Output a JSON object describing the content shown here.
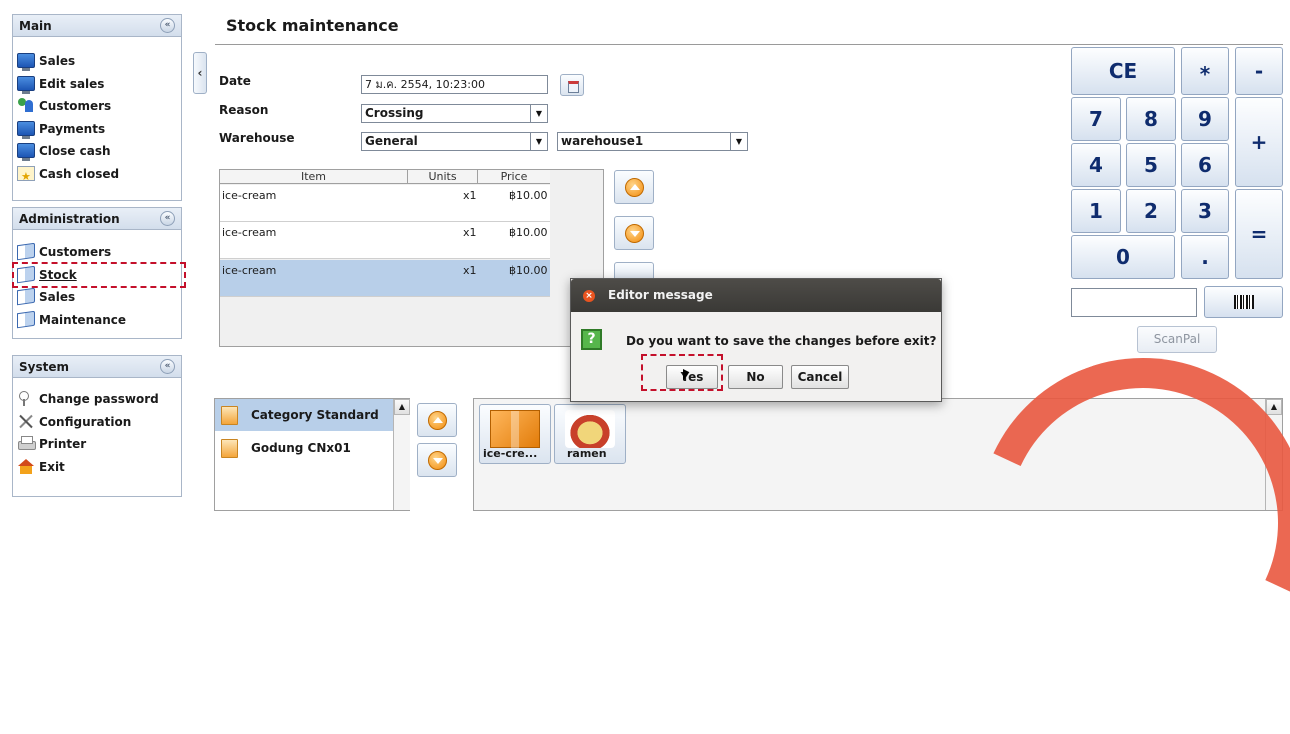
{
  "sidebar": {
    "main": {
      "title": "Main",
      "items": [
        {
          "label": "Sales",
          "icon": "monitor-icon"
        },
        {
          "label": "Edit sales",
          "icon": "monitor-icon"
        },
        {
          "label": "Customers",
          "icon": "people-icon"
        },
        {
          "label": "Payments",
          "icon": "monitor-icon"
        },
        {
          "label": "Close cash",
          "icon": "monitor-icon"
        },
        {
          "label": "Cash closed",
          "icon": "calendar-star-icon"
        }
      ]
    },
    "administration": {
      "title": "Administration",
      "items": [
        {
          "label": "Customers",
          "icon": "book-icon"
        },
        {
          "label": "Stock",
          "icon": "book-icon"
        },
        {
          "label": "Sales",
          "icon": "book-icon"
        },
        {
          "label": "Maintenance",
          "icon": "book-icon"
        }
      ]
    },
    "system": {
      "title": "System",
      "items": [
        {
          "label": "Change password",
          "icon": "key-icon"
        },
        {
          "label": "Configuration",
          "icon": "tools-icon"
        },
        {
          "label": "Printer",
          "icon": "printer-icon"
        },
        {
          "label": "Exit",
          "icon": "home-icon"
        }
      ]
    },
    "collapse_glyph": "«",
    "toggle_glyph": "‹"
  },
  "main": {
    "title": "Stock maintenance",
    "form": {
      "date_label": "Date",
      "date_value": "7 ม.ค. 2554, 10:23:00",
      "reason_label": "Reason",
      "reason_value": "Crossing",
      "warehouse_label": "Warehouse",
      "warehouse_value": "General",
      "warehouse2_value": "warehouse1"
    },
    "table": {
      "columns": [
        "Item",
        "Units",
        "Price"
      ],
      "rows": [
        {
          "item": "ice-cream",
          "units": "x1",
          "price": "฿10.00"
        },
        {
          "item": "ice-cream",
          "units": "x1",
          "price": "฿10.00"
        },
        {
          "item": "ice-cream",
          "units": "x1",
          "price": "฿10.00"
        }
      ],
      "selected_row": 2
    }
  },
  "numpad": {
    "keys": {
      "ce": "CE",
      "mul": "*",
      "minus": "-",
      "plus": "+",
      "eq": "=",
      "dot": ".",
      "k7": "7",
      "k8": "8",
      "k9": "9",
      "k4": "4",
      "k5": "5",
      "k6": "6",
      "k1": "1",
      "k2": "2",
      "k3": "3",
      "k0": "0"
    },
    "barcode_value": "",
    "scanpal_label": "ScanPal"
  },
  "catalog": {
    "categories": [
      {
        "label": "Category Standard",
        "selected": true
      },
      {
        "label": "Godung CNx01",
        "selected": false
      }
    ],
    "products": [
      {
        "label": "ice-cre...",
        "icon": "orange-box-icon"
      },
      {
        "label": "ramen",
        "icon": "ramen-bowl-icon"
      }
    ]
  },
  "dialog": {
    "title": "Editor message",
    "message": "Do you want to save the changes before exit?",
    "question_glyph": "?",
    "yes": "Yes",
    "no": "No",
    "cancel": "Cancel"
  },
  "colors": {
    "highlight_dashed": "#c4102b",
    "selection": "#b8cfe9",
    "dialog_title_bg": "#3a3936",
    "watermark": "#e95840"
  }
}
